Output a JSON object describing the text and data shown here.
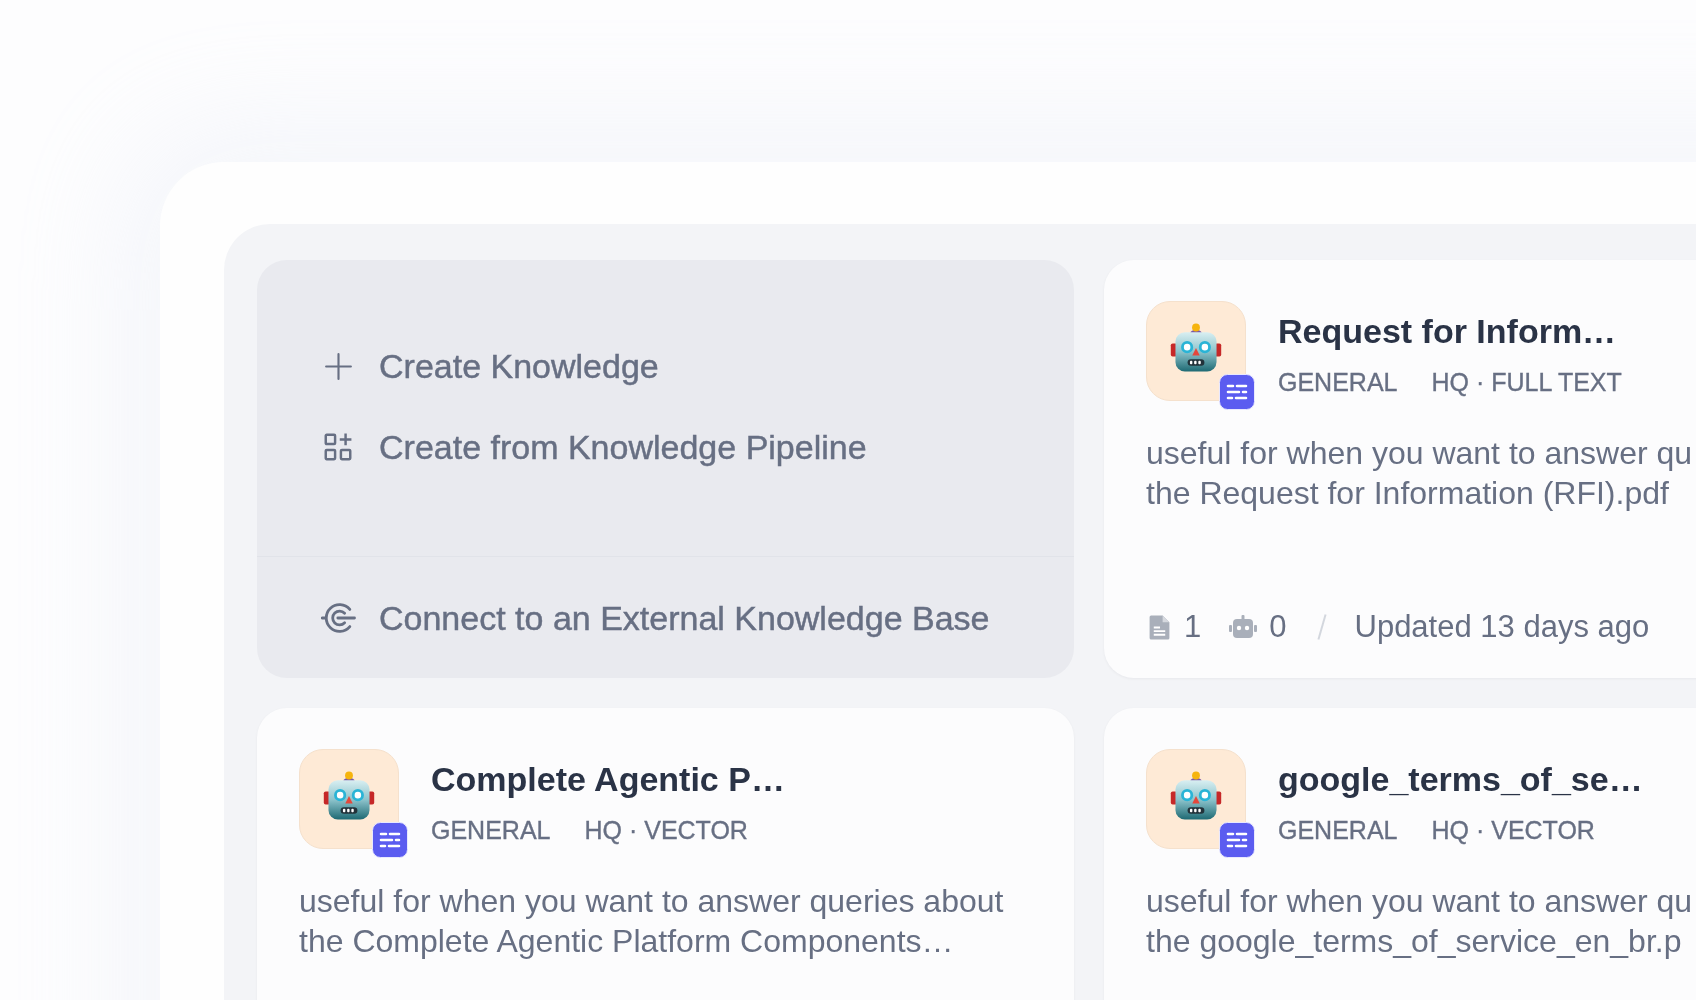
{
  "create_panel": {
    "actions": [
      {
        "kind": "create",
        "label": "Create Knowledge"
      },
      {
        "kind": "pipeline",
        "label": "Create from Knowledge Pipeline"
      }
    ],
    "connect_action": {
      "label": "Connect to an External Knowledge Base"
    }
  },
  "knowledge_cards": [
    {
      "title": "Request for Inform…",
      "tags": [
        "GENERAL",
        "HQ · FULL TEXT"
      ],
      "description": [
        "useful for when you want to answer qu",
        "the Request for Information (RFI).pdf"
      ],
      "footer": {
        "documents": "1",
        "apps": "0",
        "updated": "Updated 13 days ago"
      }
    },
    {
      "title": "Complete Agentic P…",
      "tags": [
        "GENERAL",
        "HQ · VECTOR"
      ],
      "description": [
        "useful for when you want to answer queries about",
        "the Complete Agentic Platform Components…"
      ]
    },
    {
      "title": "google_terms_of_se…",
      "tags": [
        "GENERAL",
        "HQ · VECTOR"
      ],
      "description": [
        "useful for when you want to answer qu",
        "the google_terms_of_service_en_br.p"
      ]
    }
  ]
}
